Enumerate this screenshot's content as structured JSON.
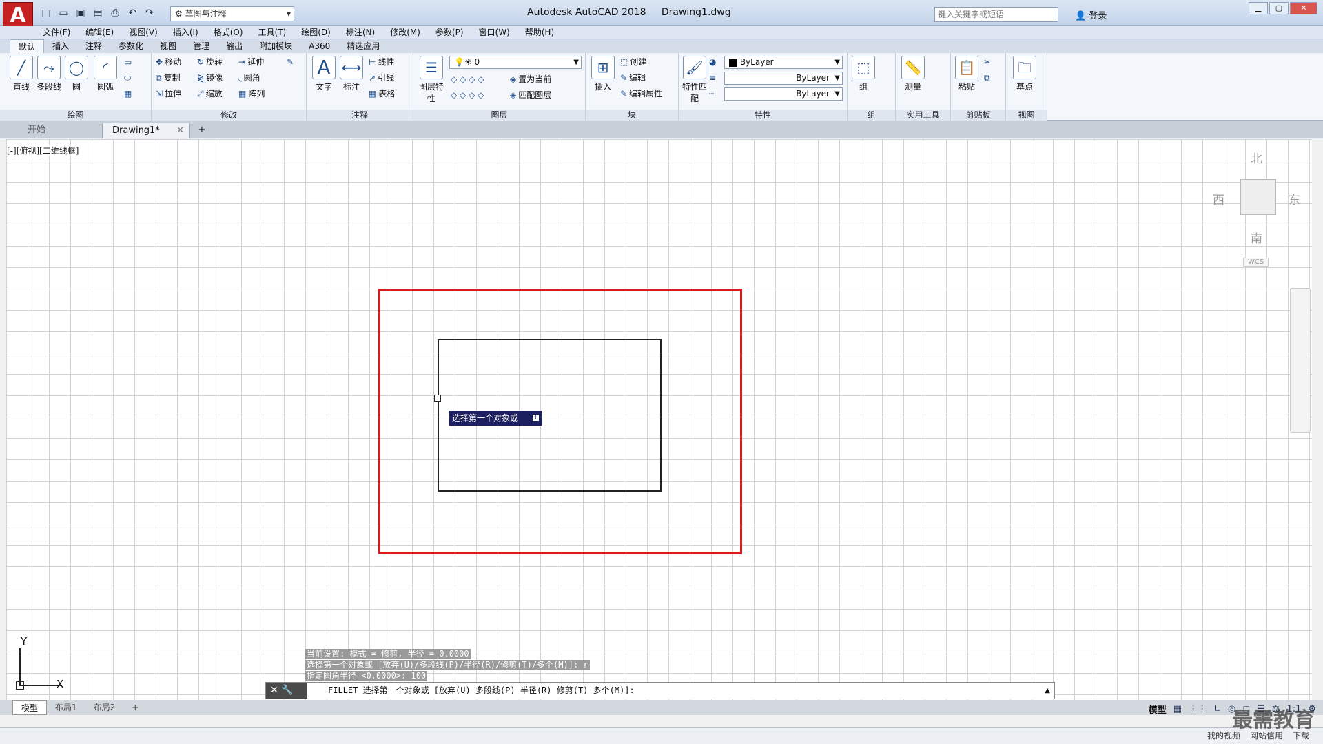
{
  "app": {
    "logo": "A",
    "title": "Autodesk AutoCAD 2018",
    "document": "Drawing1.dwg",
    "workspace": "草图与注释",
    "search_placeholder": "键入关键字或短语",
    "login": "登录"
  },
  "menu": [
    "文件(F)",
    "编辑(E)",
    "视图(V)",
    "插入(I)",
    "格式(O)",
    "工具(T)",
    "绘图(D)",
    "标注(N)",
    "修改(M)",
    "参数(P)",
    "窗口(W)",
    "帮助(H)"
  ],
  "ribbon_tabs": [
    "默认",
    "插入",
    "注释",
    "参数化",
    "视图",
    "管理",
    "输出",
    "附加模块",
    "A360",
    "精选应用"
  ],
  "ribbon": {
    "draw": {
      "title": "绘图",
      "line": "直线",
      "polyline": "多段线",
      "circle": "圆",
      "arc": "圆弧"
    },
    "modify": {
      "title": "修改",
      "move": "移动",
      "rotate": "旋转",
      "extend": "延伸",
      "copy": "复制",
      "mirror": "镜像",
      "fillet": "圆角",
      "stretch": "拉伸",
      "scale": "缩放",
      "array": "阵列"
    },
    "annotation": {
      "title": "注释",
      "text": "文字",
      "dimension": "标注",
      "linear": "线性",
      "leader": "引线",
      "table": "表格"
    },
    "layers": {
      "title": "图层",
      "properties": "图层特性",
      "current_layer": "0",
      "set_current": "置为当前",
      "match": "匹配图层"
    },
    "block": {
      "title": "块",
      "insert": "插入",
      "create": "创建",
      "edit": "编辑",
      "edit_attr": "编辑属性"
    },
    "properties": {
      "title": "特性",
      "match": "特性匹配",
      "color": "ByLayer",
      "linetype": "ByLayer",
      "lineweight": "ByLayer"
    },
    "groups": {
      "title": "组",
      "group": "组"
    },
    "utilities": {
      "title": "实用工具",
      "measure": "测量"
    },
    "clipboard": {
      "title": "剪贴板",
      "paste": "粘贴"
    },
    "view": {
      "title": "视图",
      "base": "基点"
    }
  },
  "doc_tabs": {
    "start": "开始",
    "drawing": "Drawing1*",
    "add": "+"
  },
  "viewport_label": "[-][俯视][二维线框]",
  "viewcube": {
    "north": "北",
    "south": "南",
    "east": "东",
    "west": "西",
    "wcs": "WCS"
  },
  "ucs": {
    "x": "X",
    "y": "Y"
  },
  "tooltip": "选择第一个对象或",
  "command_history": [
    "当前设置: 模式 = 修剪, 半径 = 0.0000",
    "选择第一个对象或 [放弃(U)/多段线(P)/半径(R)/修剪(T)/多个(M)]: r",
    "指定圆角半径 <0.0000>: 100"
  ],
  "command_line": "FILLET 选择第一个对象或 [放弃(U) 多段线(P) 半径(R) 修剪(T) 多个(M)]:",
  "layout_tabs": [
    "模型",
    "布局1",
    "布局2",
    "+"
  ],
  "status": {
    "model": "模型",
    "scale": "1:1"
  },
  "taskbar": [
    "我的视频",
    "网站信用",
    "下载"
  ],
  "watermark": "最需教育"
}
